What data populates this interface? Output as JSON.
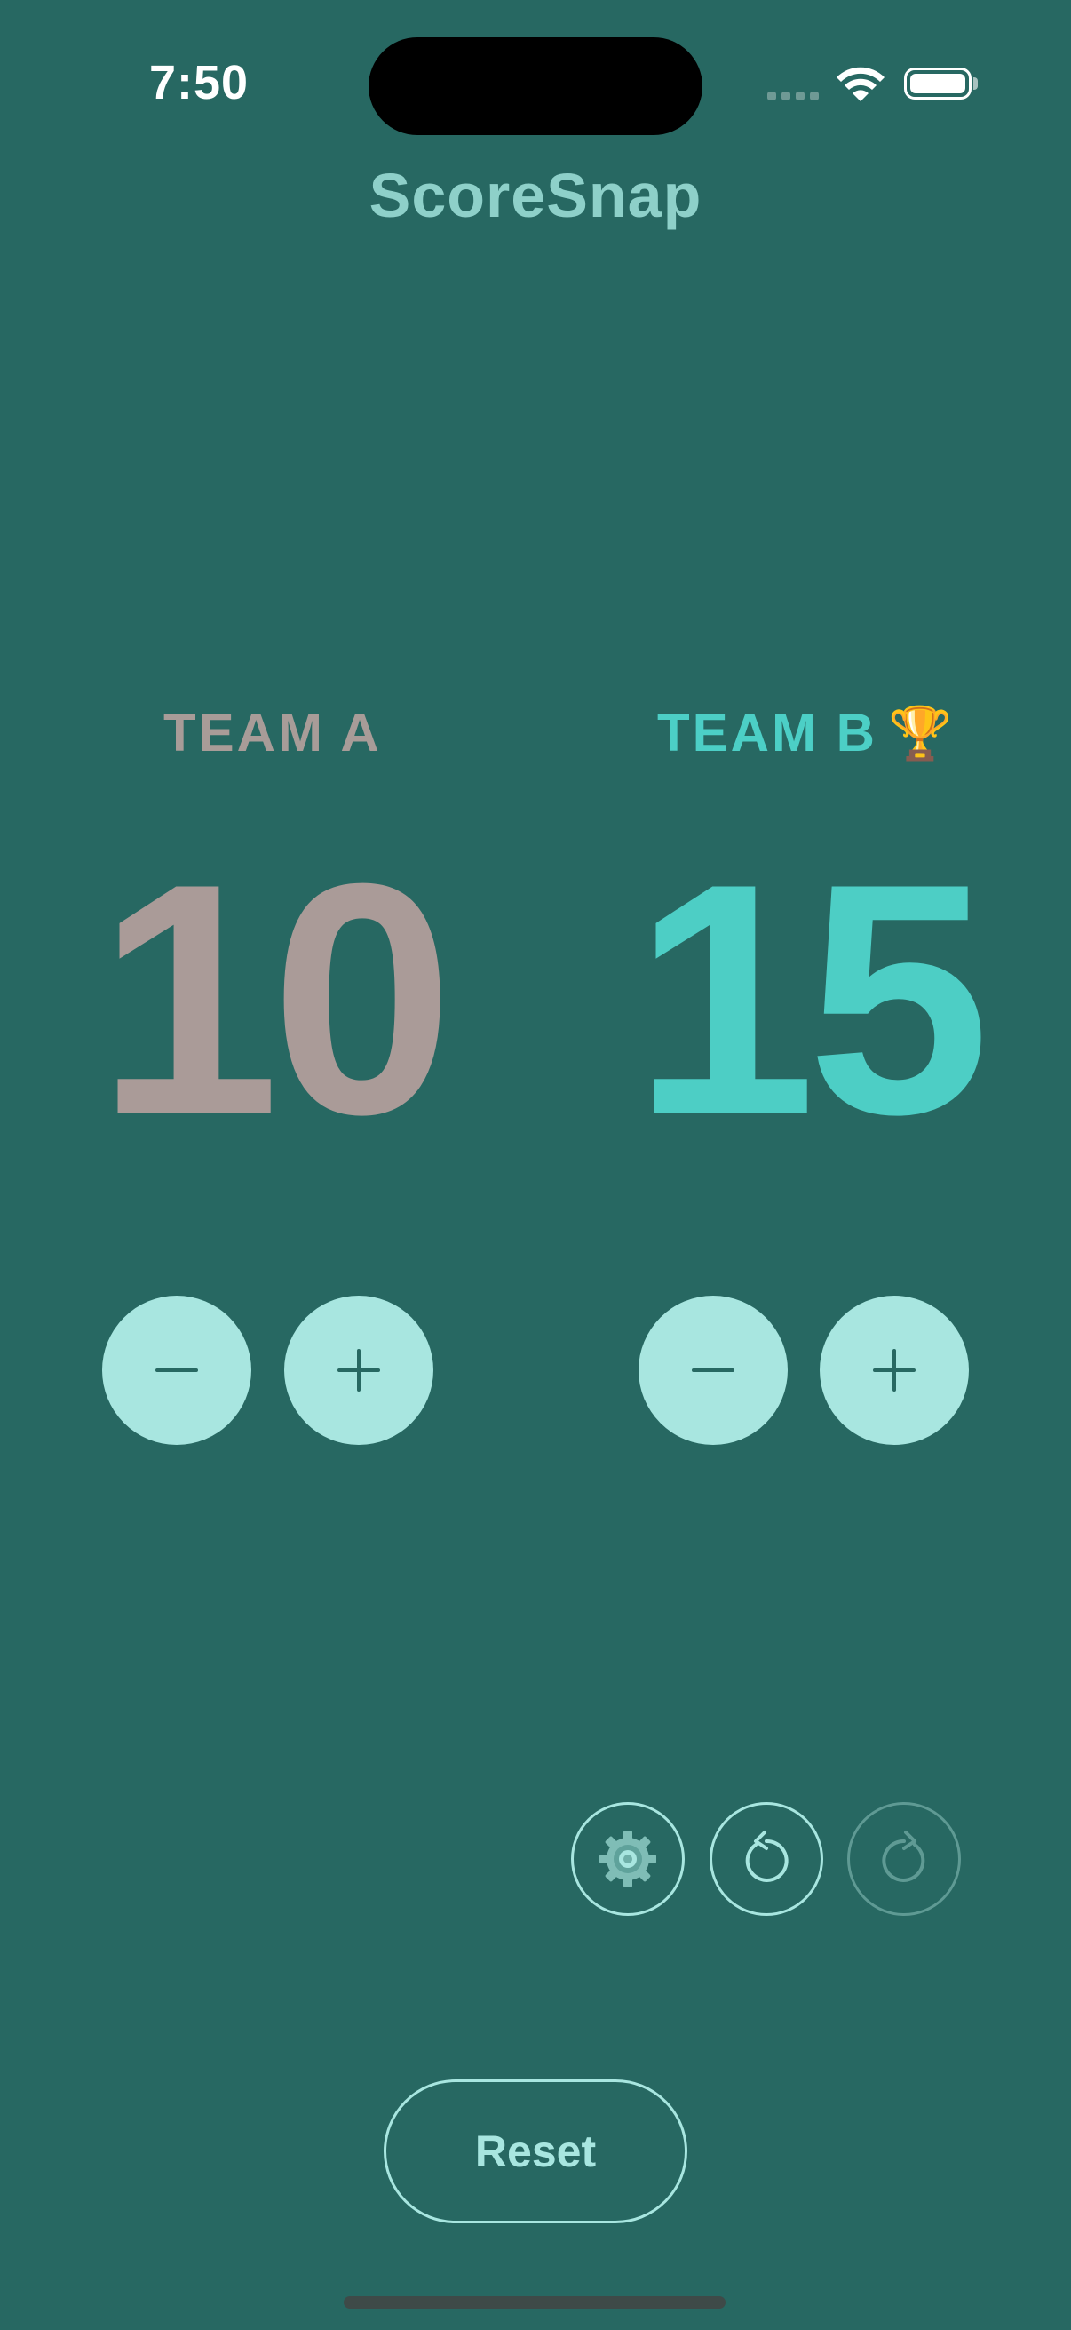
{
  "status_bar": {
    "time": "7:50",
    "signal_icon": "cellular-signal-icon",
    "wifi_icon": "wifi-icon",
    "battery_icon": "battery-icon",
    "battery_level": 1.0
  },
  "app": {
    "title": "ScoreSnap"
  },
  "teams": [
    {
      "label": "TEAM A",
      "score": "10",
      "color": "#aa9b98",
      "leader": false,
      "decrement_icon": "minus-icon",
      "increment_icon": "plus-icon"
    },
    {
      "label": "TEAM B",
      "score": "15",
      "color": "#4dcec5",
      "leader": true,
      "leader_badge": "🏆",
      "decrement_icon": "minus-icon",
      "increment_icon": "plus-icon"
    }
  ],
  "controls": {
    "settings_icon": "gear-icon",
    "undo_icon": "undo-icon",
    "redo_icon": "redo-icon",
    "redo_enabled": false
  },
  "reset": {
    "label": "Reset"
  },
  "colors": {
    "background": "#276862",
    "accent": "#a8e6e0",
    "title": "#8ed0c9"
  }
}
